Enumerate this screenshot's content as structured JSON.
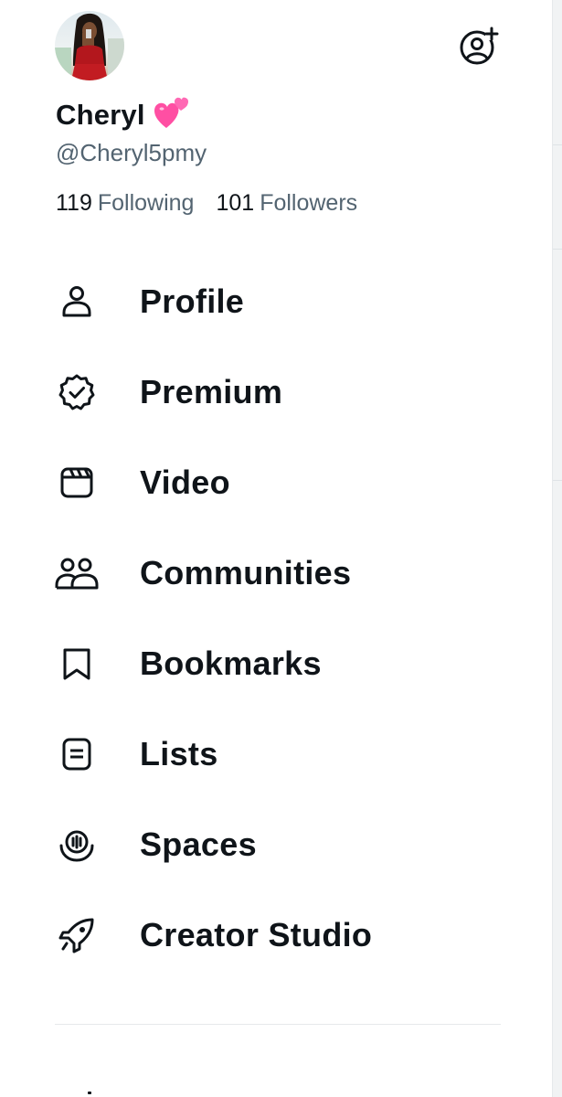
{
  "profile": {
    "name": "Cheryl",
    "name_emoji": "💕",
    "handle": "@Cheryl5pmy",
    "following_count": "119",
    "following_label": "Following",
    "followers_count": "101",
    "followers_label": "Followers"
  },
  "actions": {
    "add_account_icon": "add-account-icon"
  },
  "menu": [
    {
      "label": "Profile",
      "icon": "person-icon"
    },
    {
      "label": "Premium",
      "icon": "verified-badge-icon"
    },
    {
      "label": "Video",
      "icon": "clapperboard-icon"
    },
    {
      "label": "Communities",
      "icon": "people-icon"
    },
    {
      "label": "Bookmarks",
      "icon": "bookmark-icon"
    },
    {
      "label": "Lists",
      "icon": "list-icon"
    },
    {
      "label": "Spaces",
      "icon": "spaces-icon"
    },
    {
      "label": "Creator Studio",
      "icon": "rocket-icon"
    }
  ],
  "colors": {
    "text_primary": "#0f1419",
    "text_secondary": "#536471",
    "divider": "#e6e9eb",
    "background": "#ffffff",
    "emoji_pink": "#ff4fa3"
  }
}
